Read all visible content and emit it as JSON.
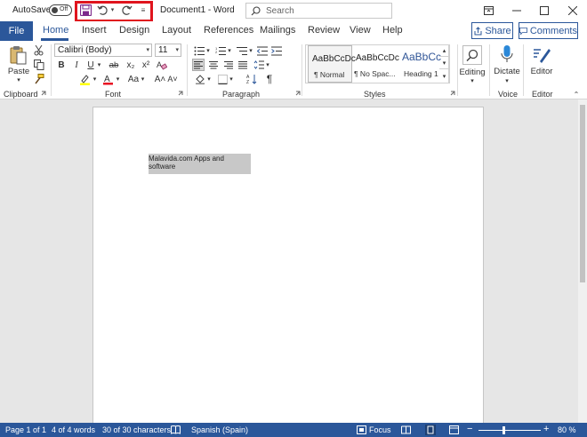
{
  "titlebar": {
    "autosave_label": "AutoSave",
    "autosave_state": "Off",
    "doc_title": "Document1  -  Word",
    "search_placeholder": "Search"
  },
  "tabs": {
    "file": "File",
    "items": [
      "Home",
      "Insert",
      "Design",
      "Layout",
      "References",
      "Mailings",
      "Review",
      "View",
      "Help"
    ],
    "active": "Home",
    "share": "Share",
    "comments": "Comments"
  },
  "ribbon": {
    "clipboard": {
      "label": "Clipboard",
      "paste": "Paste"
    },
    "font": {
      "label": "Font",
      "font_name": "Calibri (Body)",
      "font_size": "11",
      "bold": "B",
      "italic": "I",
      "underline": "U",
      "strike": "ab",
      "subscript": "x₂",
      "superscript": "x²",
      "change_case": "Aa",
      "grow": "A˄",
      "shrink": "A˅",
      "font_color_letter": "A",
      "highlight_color": "#ffff00",
      "font_color": "#e81123"
    },
    "paragraph": {
      "label": "Paragraph",
      "pilcrow": "¶"
    },
    "styles": {
      "label": "Styles",
      "items": [
        {
          "preview": "AaBbCcDc",
          "name": "¶ Normal"
        },
        {
          "preview": "AaBbCcDc",
          "name": "¶ No Spac..."
        },
        {
          "preview": "AaBbCc",
          "name": "Heading 1"
        }
      ]
    },
    "editing": {
      "label": "Editing"
    },
    "voice": {
      "label": "Voice",
      "dictate": "Dictate"
    },
    "editor": {
      "label": "Editor",
      "editor_btn": "Editor"
    }
  },
  "document": {
    "text": "Malavida.com Apps and software"
  },
  "status": {
    "page": "Page 1 of 1",
    "words": "4 of 4 words",
    "chars": "30 of 30 characters",
    "language": "Spanish (Spain)",
    "focus": "Focus",
    "zoom": "80 %",
    "zoom_level": 0.8
  },
  "colors": {
    "brand": "#2b579a",
    "qat_highlight": "#e0141e"
  }
}
